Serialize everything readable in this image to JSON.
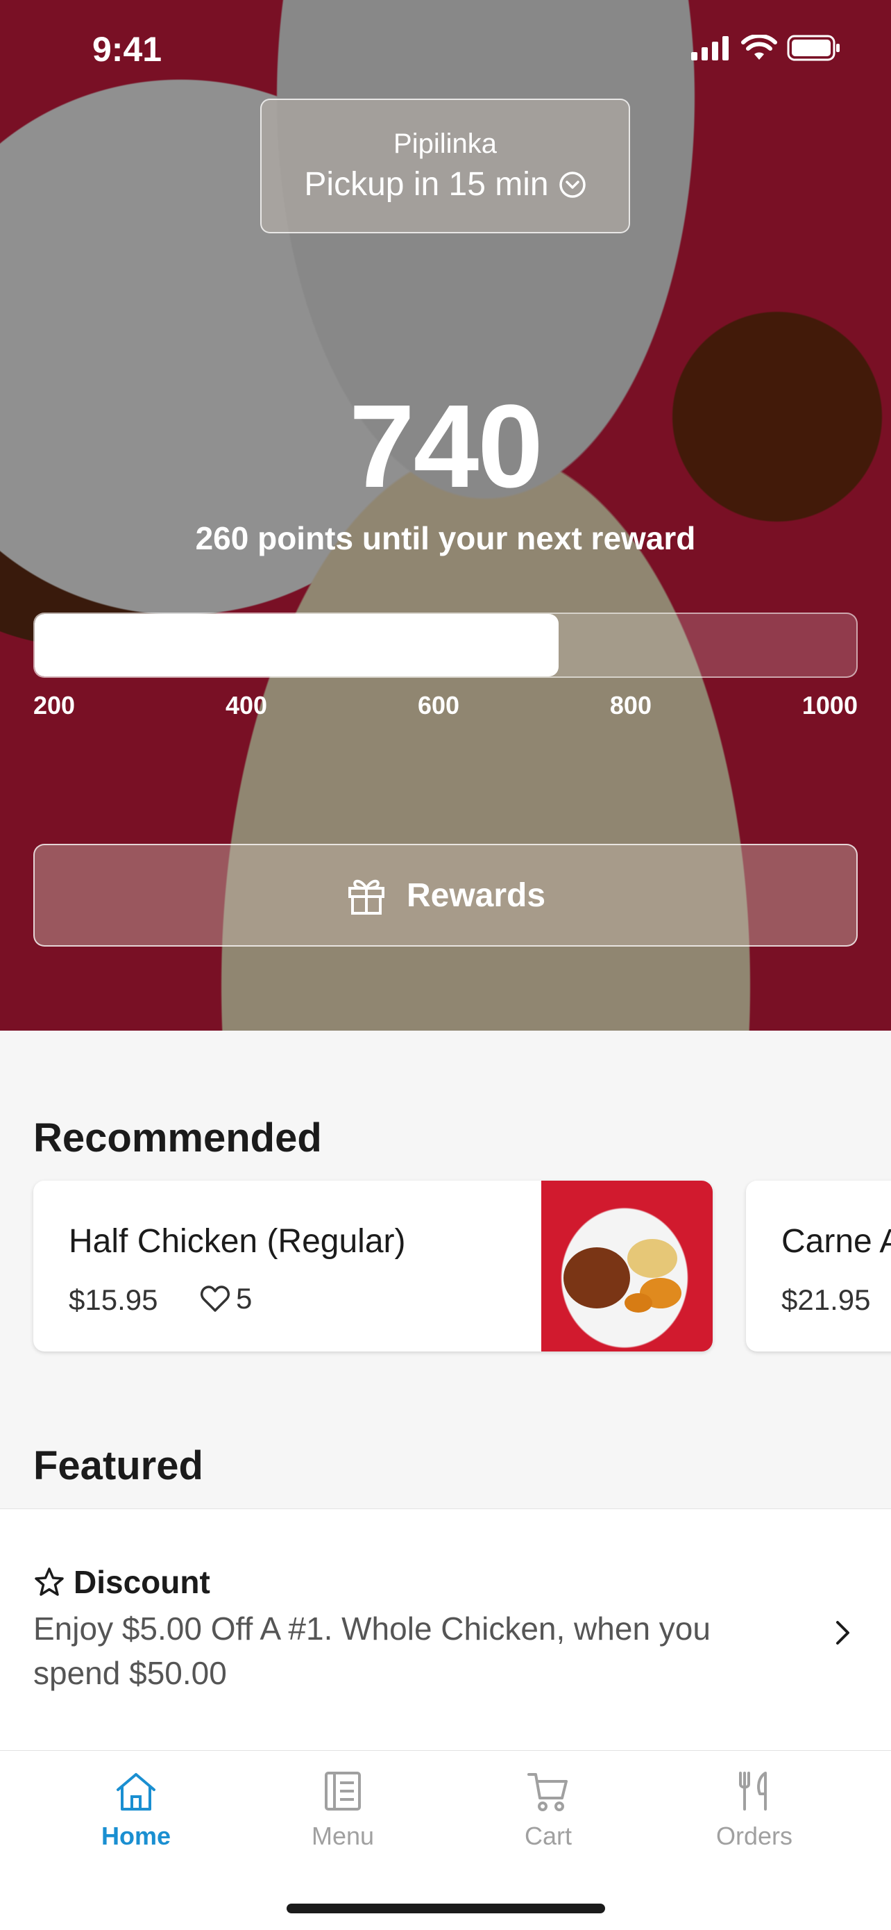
{
  "status_bar": {
    "time": "9:41"
  },
  "header": {
    "store_name": "Pipilinka",
    "pickup_label": "Pickup in 15 min"
  },
  "points": {
    "value": "740",
    "until_text": "260 points until your next reward",
    "progress_fraction": 0.638,
    "ticks": [
      "200",
      "400",
      "600",
      "800",
      "1000"
    ]
  },
  "rewards": {
    "label": "Rewards"
  },
  "recommended": {
    "title": "Recommended",
    "items": [
      {
        "name": "Half Chicken (Regular)",
        "price": "$15.95",
        "likes": "5"
      },
      {
        "name": "Carne A",
        "price": "$21.95"
      }
    ]
  },
  "featured": {
    "title": "Featured",
    "items": [
      {
        "type": "Discount",
        "description": "Enjoy $5.00 Off A #1. Whole Chicken, when you spend $50.00"
      }
    ]
  },
  "tabbar": {
    "tabs": [
      {
        "label": "Home",
        "icon": "home-icon",
        "active": true
      },
      {
        "label": "Menu",
        "icon": "menu-icon",
        "active": false
      },
      {
        "label": "Cart",
        "icon": "cart-icon",
        "active": false
      },
      {
        "label": "Orders",
        "icon": "fork-knife-icon",
        "active": false
      }
    ],
    "active_color": "#1a8fd1"
  }
}
